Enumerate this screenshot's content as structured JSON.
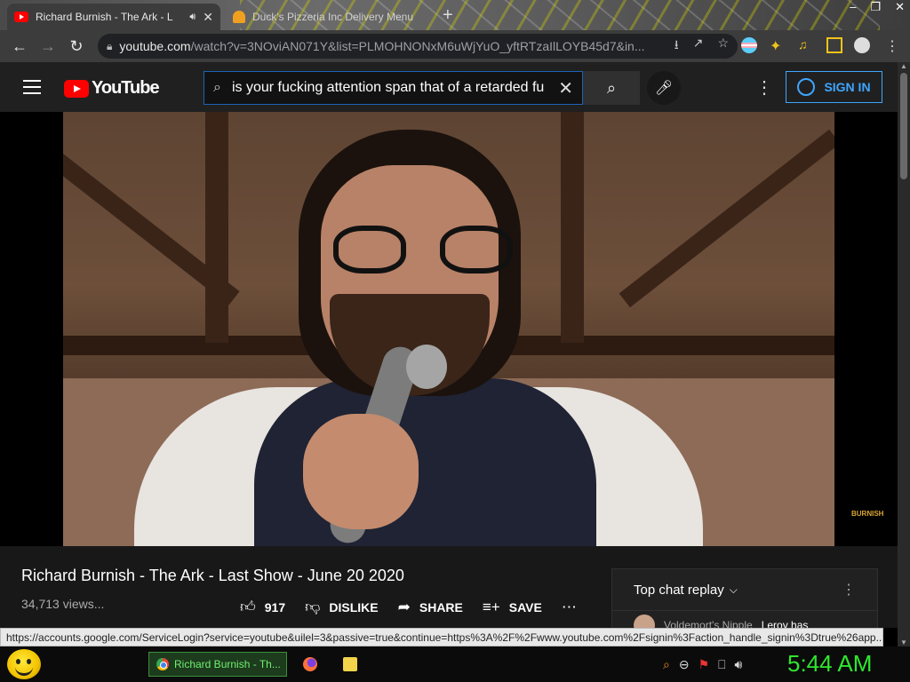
{
  "browser": {
    "tabs": [
      {
        "title": "Richard Burnish - The Ark - L",
        "active": true
      },
      {
        "title": "Duck's Pizzeria Inc Delivery Menu",
        "active": false
      }
    ],
    "url_host": "youtube.com",
    "url_rest": "/watch?v=3NOviAN071Y&list=PLMOHNONxM6uWjYuO_yftRTzaIlLOYB45d7&in..."
  },
  "youtube": {
    "logo_text": "YouTube",
    "search_value": "is your fucking attention span that of a retarded fu",
    "sign_in": "SIGN IN",
    "video": {
      "title": "Richard Burnish - The Ark - Last Show - June 20 2020",
      "views": "34,713 views...",
      "likes": "917",
      "dislike_label": "DISLIKE",
      "share_label": "SHARE",
      "save_label": "SAVE",
      "watermark": "BURNISH"
    },
    "chat": {
      "header": "Top chat replay",
      "message_author": "Voldemort's Nipple",
      "message_text": "Leroy has"
    }
  },
  "status_url": "https://accounts.google.com/ServiceLogin?service=youtube&uilel=3&passive=true&continue=https%3A%2F%2Fwww.youtube.com%2Fsignin%3Faction_handle_signin%3Dtrue%26app...",
  "taskbar": {
    "task_title": "Richard Burnish - Th...",
    "clock": "5:44 AM"
  }
}
